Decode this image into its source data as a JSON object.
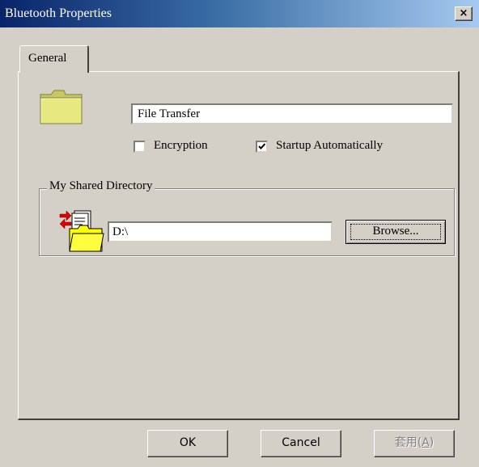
{
  "window": {
    "title": "Bluetooth Properties",
    "close_glyph": "×"
  },
  "tabs": [
    {
      "label": "General",
      "selected": true
    }
  ],
  "general": {
    "icon": "folder-icon",
    "service_name": "File Transfer",
    "encryption": {
      "label": "Encryption",
      "checked": false
    },
    "startup": {
      "label": "Startup Automatically",
      "checked": true
    }
  },
  "shared_directory": {
    "group_label": "My Shared Directory",
    "icon": "shared-folder-transfer-icon",
    "path": "D:\\",
    "browse_label": "Browse..."
  },
  "buttons": {
    "ok": "OK",
    "cancel": "Cancel",
    "apply_prefix": "套用(",
    "apply_key": "A",
    "apply_suffix": ")",
    "apply_enabled": false
  },
  "colors": {
    "face": "#d4d0c8",
    "title_start": "#0a246a",
    "title_end": "#a6caf0",
    "folder_yellow": "#e8e880"
  }
}
